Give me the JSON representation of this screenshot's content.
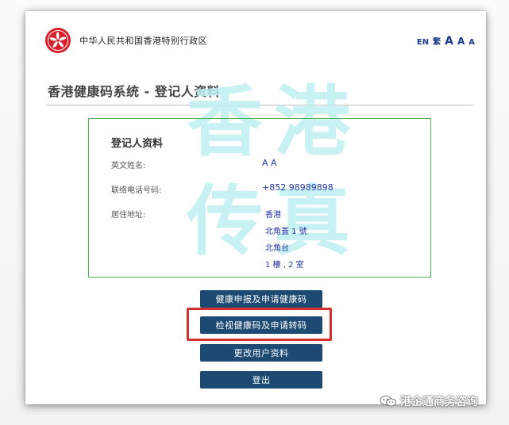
{
  "header": {
    "gov_name": "中华人民共和国香港特别行政区",
    "lang_en": "EN",
    "lang_zh": "繁",
    "font_large": "A",
    "font_medium": "A",
    "font_small": "A"
  },
  "page": {
    "title": "香港健康码系统 - 登记人资料"
  },
  "watermark": {
    "chars": [
      "香",
      "港",
      "传",
      "真"
    ]
  },
  "profile": {
    "section_title": "登记人资料",
    "english_name_label": "英文姓名:",
    "english_name_value": "A A",
    "phone_label": "联络电话号码:",
    "phone_value": "+852 98989898",
    "address_label": "居住地址:",
    "address_lines": [
      "香港",
      "北角蓋 1 號",
      "北角台",
      "1 樓 , 2 室"
    ]
  },
  "actions": {
    "health_declaration": "健康申报及申请健康码",
    "view_code": "检视健康码及申请转码",
    "edit_profile": "更改用户资料",
    "logout": "登出"
  },
  "footer": {
    "account_watermark": "港企通商务咨询"
  },
  "colors": {
    "button_bg": "#1c4a72",
    "box_border": "#4caf50",
    "highlight": "#d32f2f",
    "value_text": "#2435a8"
  }
}
